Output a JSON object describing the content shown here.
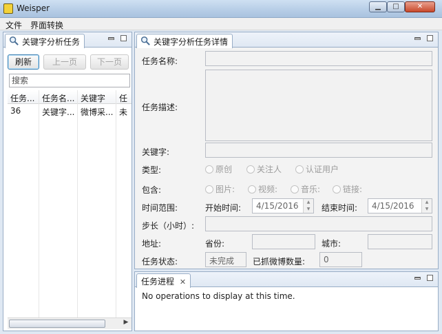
{
  "window": {
    "title": "Weisper"
  },
  "menu": [
    "文件",
    "界面转换"
  ],
  "task_list": {
    "tab_label": "关键字分析任务",
    "buttons": {
      "refresh": "刷新",
      "prev": "上一页",
      "next": "下一页"
    },
    "search_placeholder": "搜索",
    "columns": [
      "任务...",
      "任务名...",
      "关键字",
      "任"
    ],
    "rows": [
      [
        "36",
        "关键字...",
        "微博采...",
        "未"
      ]
    ]
  },
  "detail": {
    "tab_label": "关键字分析任务详情",
    "labels": {
      "name": "任务名称:",
      "description": "任务描述:",
      "keyword": "关键字:",
      "type": "类型:",
      "include": "包含:",
      "time_range": "时间范围:",
      "step": "步长（小时）:",
      "address": "地址:",
      "status": "任务状态:",
      "start_time": "开始时间:",
      "end_time": "结束时间:",
      "province": "省份:",
      "city": "城市:",
      "collected_count": "已抓微博数量:"
    },
    "type_options": [
      "原创",
      "关注人",
      "认证用户"
    ],
    "include_options": [
      "图片:",
      "视频:",
      "音乐:",
      "链接:"
    ],
    "start_date": "4/15/2016",
    "end_date": "4/15/2016",
    "status_value": "未完成",
    "collected_value": "0"
  },
  "progress": {
    "tab_label": "任务进程",
    "message": "No operations to display at this time."
  }
}
